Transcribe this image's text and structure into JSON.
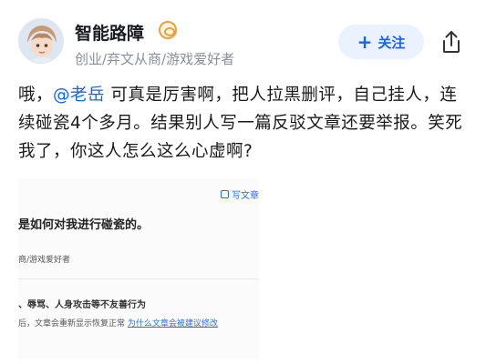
{
  "author": {
    "name": "智能路障",
    "tags": "创业/弃文从商/游戏爱好者",
    "badge_icon": "eye-badge-icon"
  },
  "actions": {
    "follow_plus": "+",
    "follow_label": "关注",
    "share_icon": "share-icon"
  },
  "post": {
    "prefix": "哦，",
    "mention": "@老岳",
    "rest": " 可真是厉害啊，把人拉黑删评，自己挂人，连续碰瓷4个多月。结果别人写一篇反驳文章还要举报。笑死我了，你这人怎么这么心虚啊?"
  },
  "screenshot": {
    "write_label": "写文章",
    "title": "是如何对我进行碰瓷的。",
    "sub": "商/游戏爱好者",
    "warn_line1": "、辱骂、人身攻击等不友善行为",
    "warn_line2_prefix": "后，文章会重新显示恢复正常 ",
    "warn_link": "为什么文章会被建议修改"
  },
  "colors": {
    "accent": "#1663f0",
    "follow_bg": "#eaf1ff",
    "muted": "#8a8f99"
  }
}
